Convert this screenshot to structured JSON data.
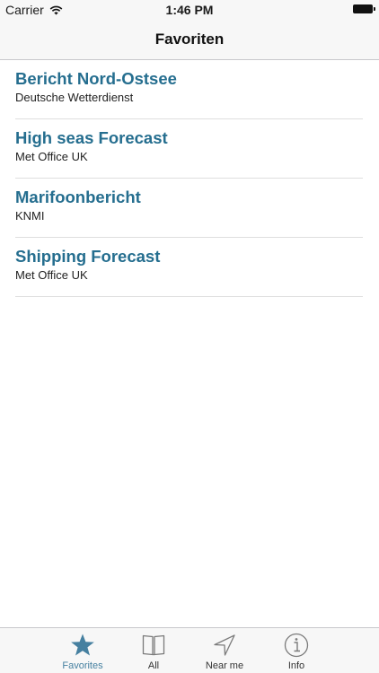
{
  "status_bar": {
    "carrier": "Carrier",
    "time": "1:46 PM"
  },
  "nav": {
    "title": "Favoriten"
  },
  "favorites": [
    {
      "title": "Bericht Nord-Ostsee",
      "subtitle": "Deutsche Wetterdienst"
    },
    {
      "title": "High seas Forecast",
      "subtitle": "Met Office UK"
    },
    {
      "title": "Marifoonbericht",
      "subtitle": "KNMI"
    },
    {
      "title": "Shipping Forecast",
      "subtitle": "Met Office UK"
    }
  ],
  "tab_bar": {
    "tabs": [
      {
        "label": "Favorites",
        "icon": "star-icon",
        "active": true
      },
      {
        "label": "All",
        "icon": "book-icon",
        "active": false
      },
      {
        "label": "Near me",
        "icon": "location-arrow-icon",
        "active": false
      },
      {
        "label": "Info",
        "icon": "info-icon",
        "active": false
      }
    ]
  },
  "colors": {
    "item_title": "#256e8f",
    "tab_active": "#4680a0",
    "tab_inactive": "#7b7b7b"
  }
}
